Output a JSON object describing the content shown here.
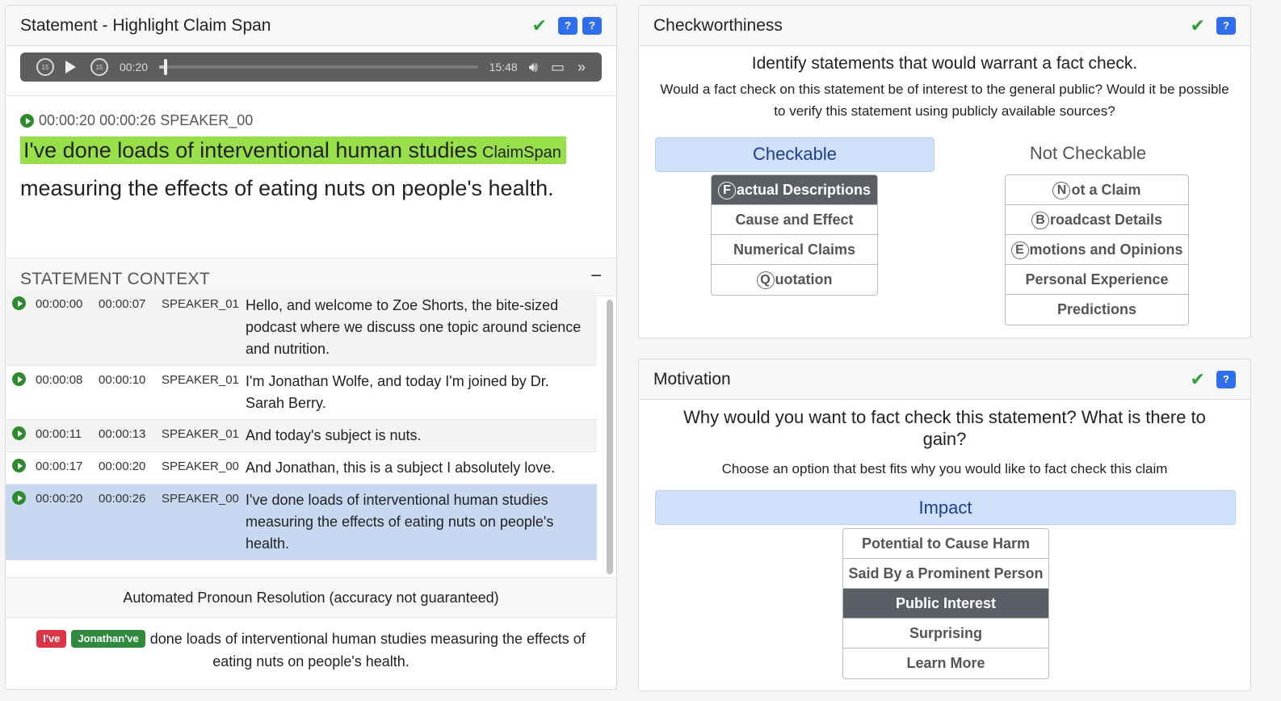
{
  "left": {
    "title": "Statement - Highlight Claim Span",
    "audio": {
      "skip_back": "15",
      "skip_forward": "15",
      "current_time": "00:20",
      "duration": "15:48",
      "progress": 0.021
    },
    "statement": {
      "start": "00:00:20",
      "end": "00:00:26",
      "speaker": "SPEAKER_00",
      "highlighted": "I've done loads of interventional human studies",
      "claim_tag": "ClaimSpan",
      "rest": "measuring the effects of eating nuts on people's health."
    },
    "context": {
      "title": "STATEMENT CONTEXT",
      "collapse": "−",
      "rows": [
        {
          "start": "00:00:00",
          "end": "00:00:07",
          "speaker": "SPEAKER_01",
          "text": "Hello, and welcome to Zoe Shorts, the bite-sized podcast where we discuss one topic around science and nutrition."
        },
        {
          "start": "00:00:08",
          "end": "00:00:10",
          "speaker": "SPEAKER_01",
          "text": "I'm Jonathan Wolfe, and today I'm joined by Dr. Sarah Berry."
        },
        {
          "start": "00:00:11",
          "end": "00:00:13",
          "speaker": "SPEAKER_01",
          "text": "And today's subject is nuts."
        },
        {
          "start": "00:00:17",
          "end": "00:00:20",
          "speaker": "SPEAKER_00",
          "text": "And Jonathan, this is a subject I absolutely love."
        },
        {
          "start": "00:00:20",
          "end": "00:00:26",
          "speaker": "SPEAKER_00",
          "text": "I've done loads of interventional human studies measuring the effects of eating nuts on people's health."
        }
      ]
    },
    "pronoun": {
      "title": "Automated Pronoun Resolution (accuracy not guaranteed)",
      "badge1": "I've",
      "badge2": "Jonathan've",
      "text": "done loads of interventional human studies measuring the effects of eating nuts on people's health."
    }
  },
  "checkworthiness": {
    "title": "Checkworthiness",
    "question": "Identify statements that would warrant a fact check.",
    "subtext": "Would a fact check on this statement be of interest to the general public? Would it be possible to verify this statement using publicly available sources?",
    "cat_checkable": "Checkable",
    "cat_not_checkable": "Not Checkable",
    "checkable_options": [
      {
        "key": "F",
        "rest": "actual Descriptions"
      },
      {
        "key": "",
        "rest": "Cause and Effect"
      },
      {
        "key": "",
        "rest": "Numerical Claims"
      },
      {
        "key": "Q",
        "rest": "uotation"
      }
    ],
    "not_checkable_options": [
      {
        "key": "N",
        "rest": "ot a Claim"
      },
      {
        "key": "B",
        "rest": "roadcast Details"
      },
      {
        "key": "E",
        "rest": "motions and Opinions"
      },
      {
        "key": "",
        "rest": "Personal Experience"
      },
      {
        "key": "",
        "rest": "Predictions"
      }
    ]
  },
  "motivation": {
    "title": "Motivation",
    "question": "Why would you want to fact check this statement? What is there to gain?",
    "subtext": "Choose an option that best fits why you would like to fact check this claim",
    "category": "Impact",
    "options": [
      "Potential to Cause Harm",
      "Said By a Prominent Person",
      "Public Interest",
      "Surprising",
      "Learn More"
    ]
  },
  "icons": {
    "check": "✔",
    "help": "?"
  },
  "colors": {
    "claim_highlight": "#98e04a",
    "selected_row": "#c7d8f0",
    "category_selected": "#cfe0fb",
    "option_active": "#5a5f66",
    "help_button": "#2f6fed"
  }
}
